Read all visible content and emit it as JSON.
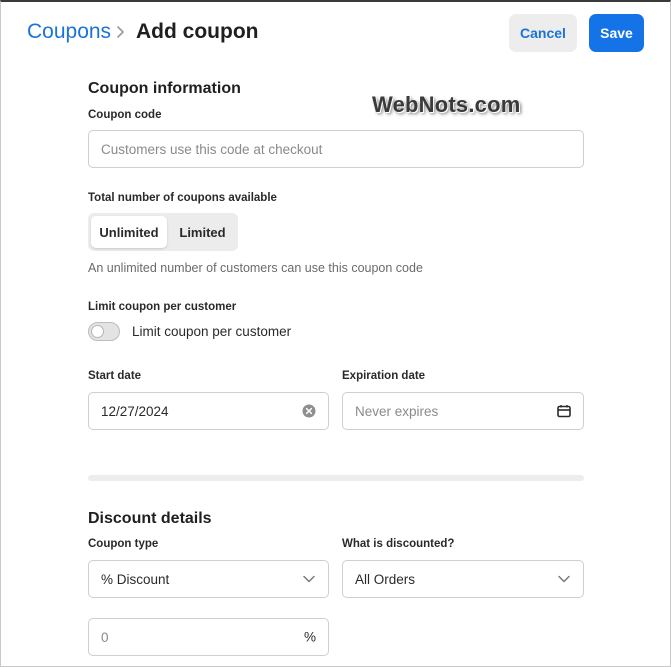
{
  "header": {
    "breadcrumb_link": "Coupons",
    "title": "Add coupon",
    "cancel_label": "Cancel",
    "save_label": "Save",
    "accent_color": "#1473e6"
  },
  "watermark": "WebNots.com",
  "coupon_info": {
    "section_title": "Coupon information",
    "code_label": "Coupon code",
    "code_placeholder": "Customers use this code at checkout",
    "total_label": "Total number of coupons available",
    "segments": [
      "Unlimited",
      "Limited"
    ],
    "selected_segment": "Unlimited",
    "help_text": "An unlimited number of customers can use this coupon code",
    "limit_label": "Limit coupon per customer",
    "limit_toggle_label": "Limit coupon per customer",
    "limit_toggle_on": false,
    "start_date_label": "Start date",
    "start_date_value": "12/27/2024",
    "expiration_label": "Expiration date",
    "expiration_placeholder": "Never expires"
  },
  "discount": {
    "section_title": "Discount details",
    "type_label": "Coupon type",
    "type_value": "% Discount",
    "what_label": "What is discounted?",
    "what_value": "All Orders",
    "amount_placeholder": "0",
    "amount_suffix": "%"
  },
  "icons": {
    "breadcrumb_separator": "chevron-right-icon",
    "clear": "clear-circle-icon",
    "calendar": "calendar-icon",
    "dropdown": "chevron-down-icon"
  }
}
